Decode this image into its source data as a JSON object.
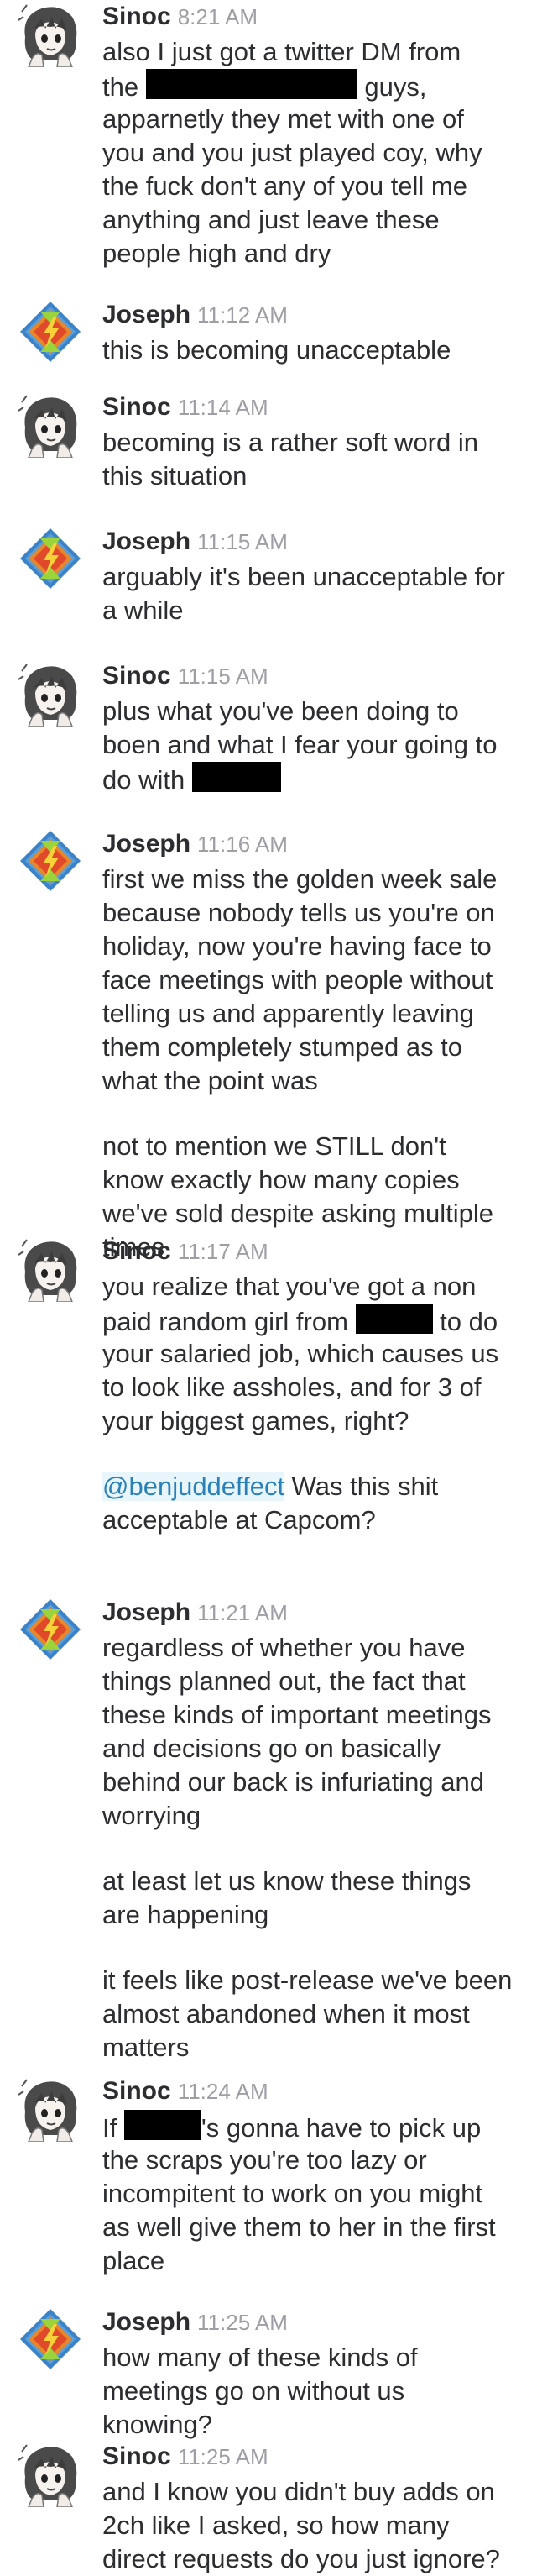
{
  "messages": [
    {
      "sender": "Sinoc",
      "time": "8:21 AM",
      "paragraphs": [
        [
          "also I just got a twitter DM from",
          "the [REDACTED] guys,",
          "apparnetly they met with one of",
          "you and you just played coy, why",
          "the fuck don't any of you tell me",
          "anything and just leave these",
          "people high and dry"
        ]
      ]
    },
    {
      "sender": "Joseph",
      "time": "11:12 AM",
      "paragraphs": [
        [
          "this is becoming unacceptable"
        ]
      ]
    },
    {
      "sender": "Sinoc",
      "time": "11:14 AM",
      "paragraphs": [
        [
          "becoming is a rather soft word in",
          "this situation"
        ]
      ]
    },
    {
      "sender": "Joseph",
      "time": "11:15 AM",
      "paragraphs": [
        [
          "arguably it's been unacceptable for",
          "a while"
        ]
      ]
    },
    {
      "sender": "Sinoc",
      "time": "11:15 AM",
      "paragraphs": [
        [
          "plus what you've been doing to",
          "boen and what I fear your going to",
          "do with [REDACTED]"
        ]
      ]
    },
    {
      "sender": "Joseph",
      "time": "11:16 AM",
      "paragraphs": [
        [
          "first we miss the golden week sale",
          "because nobody tells us you're on",
          "holiday, now you're having face to",
          "face meetings with people without",
          "telling us and apparently leaving",
          "them completely stumped as to",
          "what the point was"
        ],
        [
          "not to mention we STILL don't",
          "know exactly how many copies",
          "we've sold despite asking multiple",
          "times"
        ]
      ]
    },
    {
      "sender": "Sinoc",
      "time": "11:17 AM",
      "paragraphs": [
        [
          "you realize that you've got a non",
          "paid random girl from [REDACTED] to do",
          "your salaried job, which causes us",
          "to look like assholes, and for 3 of",
          "your biggest games, right?"
        ],
        [
          "@benjuddeffect Was this shit",
          "acceptable at Capcom?"
        ]
      ]
    },
    {
      "sender": "Joseph",
      "time": "11:21 AM",
      "paragraphs": [
        [
          "regardless of whether you have",
          "things planned out, the fact that",
          "these kinds of important meetings",
          "and decisions go on basically",
          "behind our back is infuriating and",
          "worrying"
        ],
        [
          "at least let us know these things",
          "are happening"
        ],
        [
          "it feels like post-release we've been",
          "almost abandoned when it most",
          "matters"
        ]
      ]
    },
    {
      "sender": "Sinoc",
      "time": "11:24 AM",
      "paragraphs": [
        [
          "If [REDACTED]'s gonna have to pick up",
          "the scraps you're too lazy or",
          "incompitent to work on you might",
          "as well give them to her in the first",
          "place"
        ]
      ]
    },
    {
      "sender": "Joseph",
      "time": "11:25 AM",
      "paragraphs": [
        [
          "how many of these kinds of",
          "meetings go on without us",
          "knowing?"
        ]
      ]
    },
    {
      "sender": "Sinoc",
      "time": "11:25 AM",
      "paragraphs": [
        [
          "and I know you didn't buy adds on",
          "2ch like I asked, so how many",
          "direct requests do you  just ignore?"
        ]
      ]
    }
  ],
  "mention": "@benjuddeffect",
  "redaction_marker": "[REDACTED]",
  "colors": {
    "sender": "#2c2d30",
    "timestamp": "#9e9ea6",
    "mention": "#2a80b9",
    "mention_bg": "#e8f5fa"
  }
}
